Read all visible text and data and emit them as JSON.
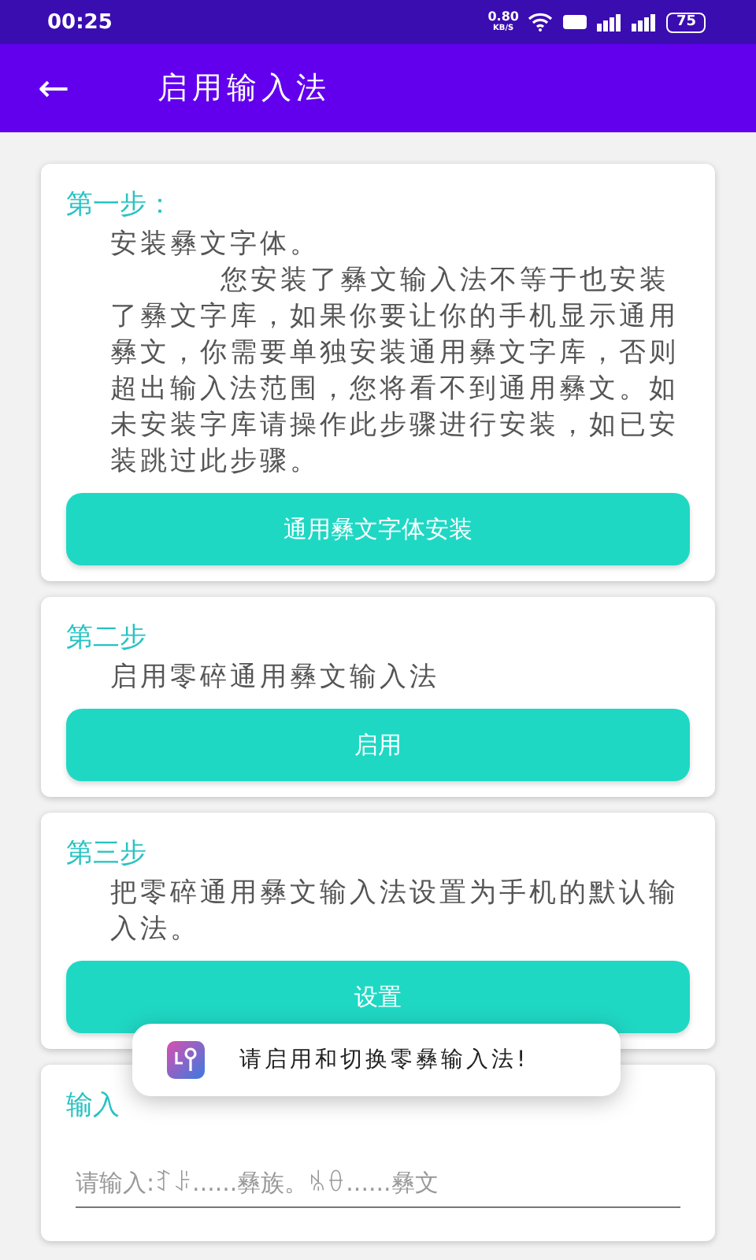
{
  "status_bar": {
    "time": "00:25",
    "speed": "0.80",
    "speed_unit": "KB/S",
    "battery": "75"
  },
  "app_bar": {
    "back": "←",
    "title": "启用输入法"
  },
  "steps": [
    {
      "heading": "第一步：",
      "lines": [
        "安装彝文字体。",
        "您安装了彝文输入法不等于也安装了彝文字库，如果你要让你的手机显示通用彝文，你需要单独安装通用彝文字库，否则超出输入法范围，您将看不到通用彝文。如未安装字库请操作此步骤进行安装，如已安装跳过此步骤。"
      ],
      "button": "通用彝文字体安装"
    },
    {
      "heading": "第二步",
      "lines": [
        "启用零碎通用彝文输入法"
      ],
      "button": "启用"
    },
    {
      "heading": "第三步",
      "lines": [
        "把零碎通用彝文输入法设置为手机的默认输入法。"
      ],
      "button": "设置"
    }
  ],
  "input_card": {
    "heading": "输入",
    "placeholder": "请输入:ꆈꌠ......彝族。ꁱꂷ......彝文"
  },
  "toast": {
    "text": "请启用和切换零彝输入法!"
  }
}
